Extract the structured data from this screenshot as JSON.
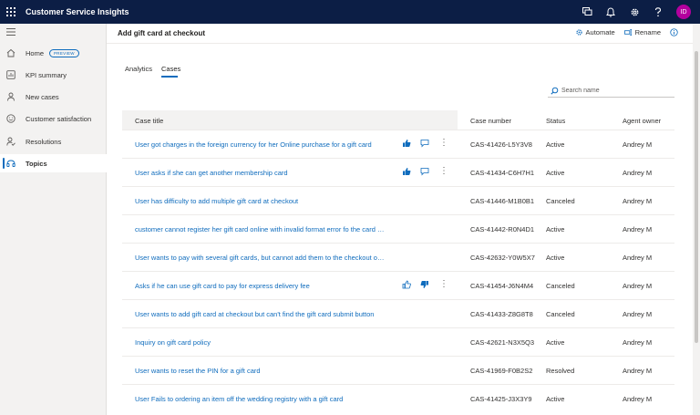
{
  "app": {
    "title": "Customer Service Insights",
    "avatar_initials": "ID",
    "avatar_color": "#b4009e"
  },
  "topbar_icons": [
    "chat-icon",
    "bell-icon",
    "gear-icon",
    "help-icon"
  ],
  "sidebar": {
    "items": [
      {
        "label": "Home",
        "icon": "home-icon",
        "badge": "PREVIEW"
      },
      {
        "label": "KPI summary",
        "icon": "chart-icon"
      },
      {
        "label": "New cases",
        "icon": "person-icon"
      },
      {
        "label": "Customer satisfaction",
        "icon": "smile-icon"
      },
      {
        "label": "Resolutions",
        "icon": "person-check-icon"
      },
      {
        "label": "Topics",
        "icon": "topics-icon",
        "active": true
      }
    ]
  },
  "header": {
    "title": "Add gift card at checkout",
    "automate_label": "Automate",
    "rename_label": "Rename"
  },
  "tabs": [
    {
      "label": "Analytics",
      "active": false
    },
    {
      "label": "Cases",
      "active": true
    }
  ],
  "search": {
    "placeholder": "Search name"
  },
  "table": {
    "columns": [
      "Case title",
      "Case number",
      "Status",
      "Agent owner"
    ],
    "rows": [
      {
        "title": "User got charges in the foreign currency for her Online purchase for a gift card",
        "number": "CAS-41426-L5Y3V8",
        "status": "Active",
        "owner": "Andrey M",
        "feedback": "up"
      },
      {
        "title": "User asks if she can get another membership card",
        "number": "CAS-41434-C6H7H1",
        "status": "Active",
        "owner": "Andrey M",
        "feedback": "up"
      },
      {
        "title": "User has difficulty to add multiple gift card at checkout",
        "number": "CAS-41446-M1B0B1",
        "status": "Canceled",
        "owner": "Andrey M",
        "feedback": ""
      },
      {
        "title": "customer cannot register her gift card online with invalid format error fo the card nu...",
        "number": "CAS-41442-R0N4D1",
        "status": "Active",
        "owner": "Andrey M",
        "feedback": ""
      },
      {
        "title": "User wants to pay with several gift cards, but cannot add them to the checkout on th...",
        "number": "CAS-42632-Y0W5X7",
        "status": "Active",
        "owner": "Andrey M",
        "feedback": ""
      },
      {
        "title": "Asks if he can use gift card to pay for express delivery fee",
        "number": "CAS-41454-J6N4M4",
        "status": "Canceled",
        "owner": "Andrey M",
        "feedback": "down"
      },
      {
        "title": "User wants to add gift card at checkout but can't find the gift card submit button",
        "number": "CAS-41433-Z8G8T8",
        "status": "Canceled",
        "owner": "Andrey M",
        "feedback": ""
      },
      {
        "title": "Inquiry on gift card policy",
        "number": "CAS-42621-N3X5Q3",
        "status": "Active",
        "owner": "Andrey M",
        "feedback": ""
      },
      {
        "title": "User wants to reset the PIN for a gift card",
        "number": "CAS-41969-F0B2S2",
        "status": "Resolved",
        "owner": "Andrey M",
        "feedback": ""
      },
      {
        "title": "User Fails to ordering an item off the wedding registry with a gift card",
        "number": "CAS-41425-J3X3Y9",
        "status": "Active",
        "owner": "Andrey M",
        "feedback": ""
      }
    ]
  },
  "colors": {
    "accent": "#0f6cbd",
    "topbar": "#0c1e45"
  }
}
